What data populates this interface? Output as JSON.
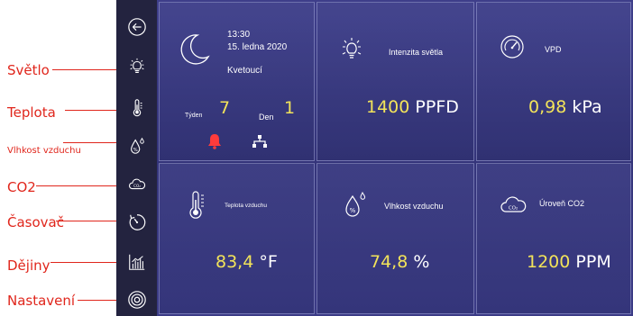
{
  "callouts": {
    "light": "Světlo",
    "temperature": "Teplota",
    "humidity": "Vlhkost vzduchu",
    "co2": "CO2",
    "timer": "Časovač",
    "history": "Dějiny",
    "settings": "Nastavení"
  },
  "status": {
    "time": "13:30",
    "date": "15. ledna 2020",
    "phase": "Kvetoucí",
    "week_label": "Týden",
    "week_value": "7",
    "day_label": "Den",
    "day_value": "1"
  },
  "light": {
    "label": "Intenzita světla",
    "value": "1400",
    "unit": "PPFD"
  },
  "vpd": {
    "label": "VPD",
    "value": "0,98",
    "unit": "kPa"
  },
  "temperature": {
    "label": "Teplota vzduchu",
    "value": "83,4",
    "unit": "°F"
  },
  "humidity": {
    "label": "Vlhkost vzduchu",
    "value": "74,8",
    "unit": "%"
  },
  "co2": {
    "label": "Úroveň CO2",
    "value": "1200",
    "unit": "PPM",
    "icon_text": "CO₂"
  },
  "colors": {
    "accent_value": "#f2e35a",
    "alarm": "#ff3b3b",
    "sidebar": "#23233f",
    "panel": "#3a3a84"
  }
}
